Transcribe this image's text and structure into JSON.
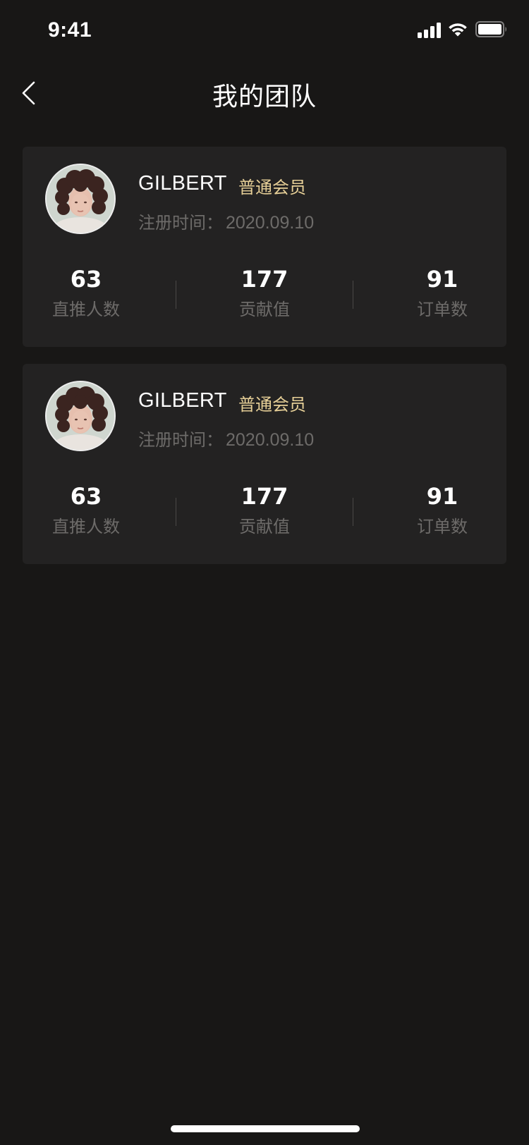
{
  "status_bar": {
    "time": "9:41"
  },
  "header": {
    "title": "我的团队",
    "back_icon": "chevron-left-icon"
  },
  "members": [
    {
      "name": "GILBERT",
      "level": "普通会员",
      "reg_label": "注册时间：",
      "reg_date": "2020.09.10",
      "stats": [
        {
          "value": "63",
          "label": "直推人数"
        },
        {
          "value": "177",
          "label": "贡献值"
        },
        {
          "value": "91",
          "label": "订单数"
        }
      ]
    },
    {
      "name": "GILBERT",
      "level": "普通会员",
      "reg_label": "注册时间：",
      "reg_date": "2020.09.10",
      "stats": [
        {
          "value": "63",
          "label": "直推人数"
        },
        {
          "value": "177",
          "label": "贡献值"
        },
        {
          "value": "91",
          "label": "订单数"
        }
      ]
    }
  ],
  "colors": {
    "background": "#181716",
    "card": "#232222",
    "accent_gold": "#e6cf97",
    "muted_text": "#6d6b69"
  }
}
